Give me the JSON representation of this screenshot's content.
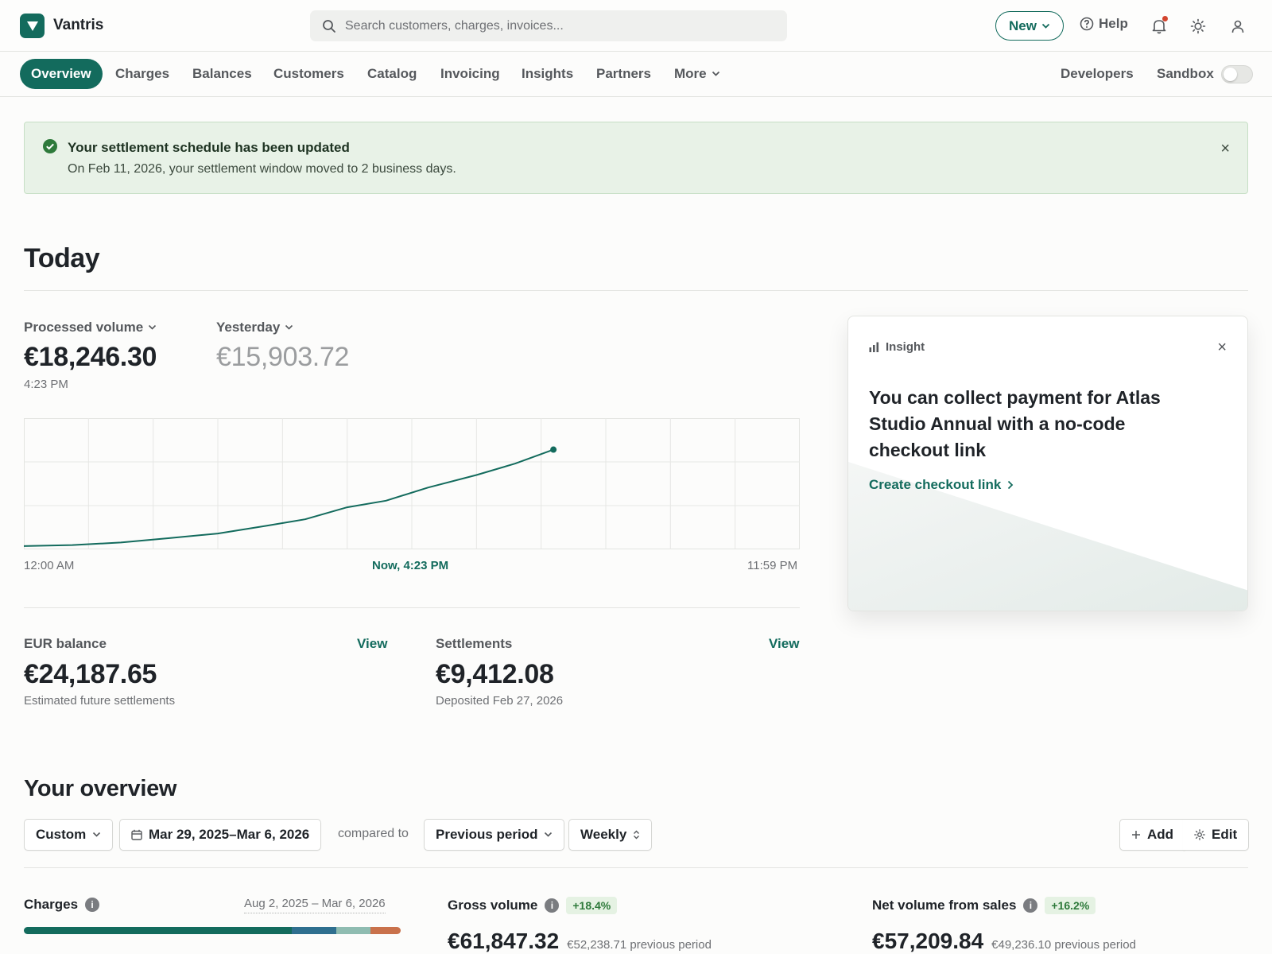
{
  "brand": {
    "name": "Vantris",
    "logo_letter": "V",
    "accent": "#136b5d"
  },
  "search": {
    "placeholder": "Search customers, charges, invoices..."
  },
  "topbar": {
    "new_label": "New",
    "help_label": "Help",
    "icons": [
      "search-icon",
      "chevron-down-icon",
      "help-circle-icon",
      "bell-icon",
      "sun-icon",
      "user-icon"
    ]
  },
  "nav": {
    "items": [
      "Overview",
      "Charges",
      "Balances",
      "Customers",
      "Catalog",
      "Invoicing",
      "Insights",
      "Partners",
      "More"
    ],
    "active": "Overview",
    "developers": "Developers",
    "sandbox": "Sandbox",
    "sandbox_on": false
  },
  "alert": {
    "title": "Your settlement schedule has been updated",
    "body": "On Feb 11, 2026, your settlement window moved to 2 business days.",
    "close": "×",
    "color": "#e8f2e7"
  },
  "today": {
    "heading": "Today",
    "processed_label": "Processed volume",
    "processed_value": "€18,246.30",
    "processed_time": "4:23 PM",
    "compare_label": "Yesterday",
    "compare_value": "€15,903.72",
    "axis_start": "12:00 AM",
    "axis_now": "Now, 4:23 PM",
    "axis_end": "11:59 PM"
  },
  "chart_data": {
    "type": "line",
    "x_range": [
      "12:00 AM",
      "11:59 PM"
    ],
    "x_hours": [
      0,
      1.5,
      3,
      4.5,
      6,
      7.5,
      8.7,
      10,
      11.2,
      12.5,
      14,
      15.2,
      16.38
    ],
    "values": [
      600,
      780,
      1250,
      2050,
      2900,
      4300,
      5500,
      7700,
      8900,
      11300,
      13600,
      15700,
      18246.3
    ],
    "series": [
      {
        "values": [
          600,
          780,
          1250,
          2050,
          2900,
          4300,
          5500,
          7700,
          8900,
          11300,
          13600,
          15700,
          18246.3
        ]
      }
    ],
    "ylim": [
      0,
      24000
    ],
    "grid": true,
    "color": "#136b5d"
  },
  "balances": {
    "eur_label": "EUR balance",
    "eur_value": "€24,187.65",
    "eur_sub": "Estimated future settlements",
    "settle_label": "Settlements",
    "settle_value": "€9,412.08",
    "settle_sub": "Deposited Feb 27, 2026",
    "view": "View"
  },
  "insight": {
    "tag": "Insight",
    "text": "You can collect payment for Atlas Studio Annual with a no-code checkout link",
    "cta": "Create checkout link",
    "close": "×"
  },
  "overview": {
    "heading": "Your overview",
    "custom": "Custom",
    "date_range": "Mar 29, 2025–Mar 6, 2026",
    "compared_to": "compared to",
    "previous": "Previous period",
    "weekly": "Weekly",
    "add": "Add",
    "edit": "Edit"
  },
  "metrics": [
    {
      "label": "Charges",
      "range": "Aug 2, 2025 – Mar 6, 2026",
      "segments": [
        {
          "share": 0.71,
          "color": "#136b5d"
        },
        {
          "share": 0.12,
          "color": "#2f6f8f"
        },
        {
          "share": 0.09,
          "color": "#8fbcb1"
        },
        {
          "share": 0.08,
          "color": "#c9714b"
        }
      ]
    },
    {
      "label": "Gross volume",
      "delta": "+18.4%",
      "value": "€61,847.32",
      "previous": "€52,238.71 previous period"
    },
    {
      "label": "Net volume from sales",
      "delta": "+16.2%",
      "value": "€57,209.84",
      "previous": "€49,236.10 previous period"
    }
  ]
}
